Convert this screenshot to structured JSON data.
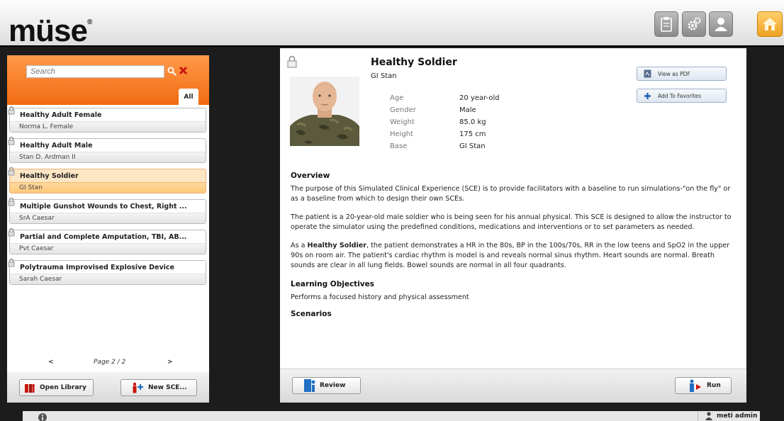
{
  "app": {
    "logo": "müse",
    "logo_mark": "®"
  },
  "header_buttons": [
    {
      "icon": "clipboard-icon"
    },
    {
      "icon": "gears-icon"
    },
    {
      "icon": "user-icon"
    },
    {
      "icon": "home-icon"
    }
  ],
  "search": {
    "placeholder": "Search",
    "value": ""
  },
  "tabs": {
    "all": "All"
  },
  "sce_list": [
    {
      "title": "Healthy Adult Female",
      "subtitle": "Norma L. Female",
      "selected": false
    },
    {
      "title": "Healthy Adult Male",
      "subtitle": "Stan D. Ardman II",
      "selected": false
    },
    {
      "title": "Healthy Soldier",
      "subtitle": "GI Stan",
      "selected": true
    },
    {
      "title": "Multiple Gunshot Wounds to Chest, Right ...",
      "subtitle": "SrA Caesar",
      "selected": false
    },
    {
      "title": "Partial and Complete Amputation, TBI, AB...",
      "subtitle": "Pvt Caesar",
      "selected": false
    },
    {
      "title": "Polytrauma Improvised Explosive Device",
      "subtitle": "Sarah Caesar",
      "selected": false
    }
  ],
  "pager": {
    "prev": "<",
    "label": "Page 2 / 2",
    "next": ">"
  },
  "left_footer": {
    "open_library": "Open Library",
    "new_sce": "New SCE..."
  },
  "detail": {
    "title": "Healthy Soldier",
    "subtitle": "GI Stan",
    "properties": [
      {
        "key": "Age",
        "value": "20 year-old"
      },
      {
        "key": "Gender",
        "value": "Male"
      },
      {
        "key": "Weight",
        "value": "85.0 kg"
      },
      {
        "key": "Height",
        "value": "175 cm"
      },
      {
        "key": "Base",
        "value": "GI Stan"
      }
    ],
    "view_pdf": "View as PDF",
    "add_favorites": "Add To Favorites",
    "overview_heading": "Overview",
    "overview_p1": "The purpose of this Simulated Clinical Experience (SCE) is to provide facilitators with a baseline to run simulations-\"on the fly\" or as a baseline from which to design their own SCEs.",
    "overview_p2": "The patient is a 20-year-old male soldier who is being seen for his annual physical. This SCE is designed to allow the instructor to operate the simulator using the predefined conditions, medications and interventions or to set parameters as needed.",
    "overview_p3_prefix": "As a ",
    "overview_p3_bold": "Healthy Soldier",
    "overview_p3_rest": ", the patient demonstrates a HR in the 80s, BP in the 100s/70s, RR in the low teens and SpO2 in the upper 90s on room air. The patient's cardiac rhythm is model is and reveals normal sinus rhythm. Heart sounds are normal. Breath sounds are clear in all lung fields. Bowel sounds are normal in all four quadrants.",
    "objectives_heading": "Learning Objectives",
    "objectives_text": "Performs a focused history and physical assessment",
    "scenarios_heading": "Scenarios"
  },
  "main_footer": {
    "review": "Review",
    "run": "Run"
  },
  "status_bar": {
    "user": "meti admin"
  },
  "colors": {
    "accent_orange": "#f26a12",
    "selected_item": "#ffc878",
    "home_button": "#f0a123"
  }
}
